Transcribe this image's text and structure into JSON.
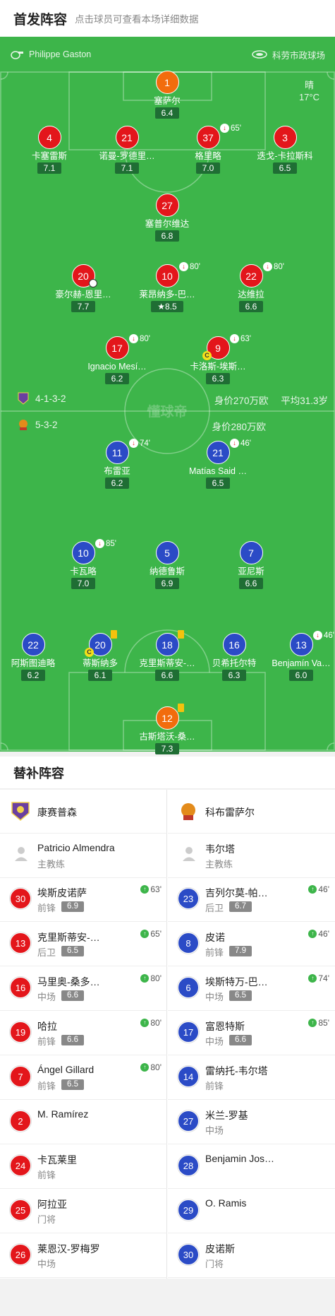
{
  "header": {
    "title": "首发阵容",
    "subtitle": "点击球员可查看本场详细数据"
  },
  "top_bar": {
    "referee": "Philippe Gaston",
    "stadium": "科劳市政球场",
    "referee_icon": "whistle-icon",
    "stadium_icon": "stadium-icon"
  },
  "weather": {
    "condition": "晴",
    "temperature": "17°C"
  },
  "watermark": "懂球帝",
  "home_info": {
    "formation": "4-1-3-2",
    "value": "身价270万欧",
    "age": "平均31.3岁"
  },
  "away_info": {
    "formation": "5-3-2",
    "value": "身价280万欧"
  },
  "home_players": [
    {
      "num": "1",
      "name": "塞萨尔",
      "rating": "6.4",
      "color": "orange"
    },
    {
      "num": "4",
      "name": "卡塞雷斯",
      "rating": "7.1",
      "color": "red"
    },
    {
      "num": "21",
      "name": "诺曼-罗德里…",
      "rating": "7.1",
      "color": "red"
    },
    {
      "num": "37",
      "name": "格里略",
      "rating": "7.0",
      "color": "red",
      "sub": "65'"
    },
    {
      "num": "3",
      "name": "迭戈-卡拉斯科",
      "rating": "6.5",
      "color": "red"
    },
    {
      "num": "27",
      "name": "塞普尔维达",
      "rating": "6.8",
      "color": "red"
    },
    {
      "num": "20",
      "name": "豪尔赫-恩里…",
      "rating": "7.7",
      "color": "red"
    },
    {
      "num": "10",
      "name": "莱昂纳多-巴…",
      "rating": "8.5",
      "color": "red",
      "sub": "80'"
    },
    {
      "num": "22",
      "name": "达维拉",
      "rating": "6.6",
      "color": "red",
      "sub": "80'"
    },
    {
      "num": "17",
      "name": "Ignacio Mesí…",
      "rating": "6.2",
      "color": "red",
      "sub": "80'"
    },
    {
      "num": "9",
      "name": "卡洛斯-埃斯…",
      "rating": "6.3",
      "color": "red",
      "sub": "63'"
    }
  ],
  "away_players": [
    {
      "num": "11",
      "name": "布雷亚",
      "rating": "6.2",
      "color": "blue",
      "sub": "74'"
    },
    {
      "num": "21",
      "name": "Matías Said …",
      "rating": "6.5",
      "color": "blue",
      "sub": "46'"
    },
    {
      "num": "10",
      "name": "卡瓦略",
      "rating": "7.0",
      "color": "blue",
      "sub": "85'"
    },
    {
      "num": "5",
      "name": "纳德鲁斯",
      "rating": "6.9",
      "color": "blue"
    },
    {
      "num": "7",
      "name": "亚尼斯",
      "rating": "6.6",
      "color": "blue"
    },
    {
      "num": "22",
      "name": "阿斯图迪略",
      "rating": "6.2",
      "color": "blue"
    },
    {
      "num": "20",
      "name": "蒂斯纳多",
      "rating": "6.1",
      "color": "blue"
    },
    {
      "num": "18",
      "name": "克里斯蒂安-…",
      "rating": "6.6",
      "color": "blue"
    },
    {
      "num": "16",
      "name": "贝希托尔特",
      "rating": "6.3",
      "color": "blue"
    },
    {
      "num": "13",
      "name": "Benjamín Va…",
      "rating": "6.0",
      "color": "blue",
      "sub": "46'"
    },
    {
      "num": "12",
      "name": "古斯塔沃-桑…",
      "rating": "7.3",
      "color": "orange"
    }
  ],
  "subs_title": "替补阵容",
  "home_team": {
    "name": "康赛普森",
    "coach": "Patricio Almendra",
    "coach_label": "主教练"
  },
  "away_team": {
    "name": "科布雷萨尔",
    "coach": "韦尔塔",
    "coach_label": "主教练"
  },
  "home_subs": [
    {
      "num": "30",
      "name": "埃斯皮诺萨",
      "pos": "前锋",
      "rating": "6.9",
      "min": "63'"
    },
    {
      "num": "13",
      "name": "克里斯蒂安-…",
      "pos": "后卫",
      "rating": "6.5",
      "min": "65'"
    },
    {
      "num": "16",
      "name": "马里奥-桑多…",
      "pos": "中场",
      "rating": "6.6",
      "min": "80'"
    },
    {
      "num": "19",
      "name": "哈拉",
      "pos": "前锋",
      "rating": "6.6",
      "min": "80'"
    },
    {
      "num": "7",
      "name": "Ángel Gillard",
      "pos": "前锋",
      "rating": "6.5",
      "min": "80'"
    },
    {
      "num": "2",
      "name": "M. Ramírez",
      "pos": "",
      "rating": "",
      "min": ""
    },
    {
      "num": "24",
      "name": "卡瓦莱里",
      "pos": "前锋",
      "rating": "",
      "min": ""
    },
    {
      "num": "25",
      "name": "阿拉亚",
      "pos": "门将",
      "rating": "",
      "min": ""
    },
    {
      "num": "26",
      "name": "莱恩汉-罗梅罗",
      "pos": "中场",
      "rating": "",
      "min": ""
    }
  ],
  "away_subs": [
    {
      "num": "23",
      "name": "吉列尔莫-帕…",
      "pos": "后卫",
      "rating": "6.7",
      "min": "46'"
    },
    {
      "num": "8",
      "name": "皮诺",
      "pos": "前锋",
      "rating": "7.9",
      "min": "46'"
    },
    {
      "num": "6",
      "name": "埃斯特万-巴…",
      "pos": "中场",
      "rating": "6.5",
      "min": "74'"
    },
    {
      "num": "17",
      "name": "富恩特斯",
      "pos": "中场",
      "rating": "6.6",
      "min": "85'"
    },
    {
      "num": "14",
      "name": "雷纳托-韦尔塔",
      "pos": "前锋",
      "rating": "",
      "min": ""
    },
    {
      "num": "27",
      "name": "米兰-罗基",
      "pos": "中场",
      "rating": "",
      "min": ""
    },
    {
      "num": "28",
      "name": "Benjamin Jos…",
      "pos": "",
      "rating": "",
      "min": ""
    },
    {
      "num": "29",
      "name": "O. Ramis",
      "pos": "",
      "rating": "",
      "min": ""
    },
    {
      "num": "30",
      "name": "皮诺斯",
      "pos": "门将",
      "rating": "",
      "min": ""
    }
  ],
  "colors": {
    "pitch": "#3db54a",
    "home": "#e3161b",
    "away": "#2b4bc6",
    "keeper": "#f26c0d"
  }
}
